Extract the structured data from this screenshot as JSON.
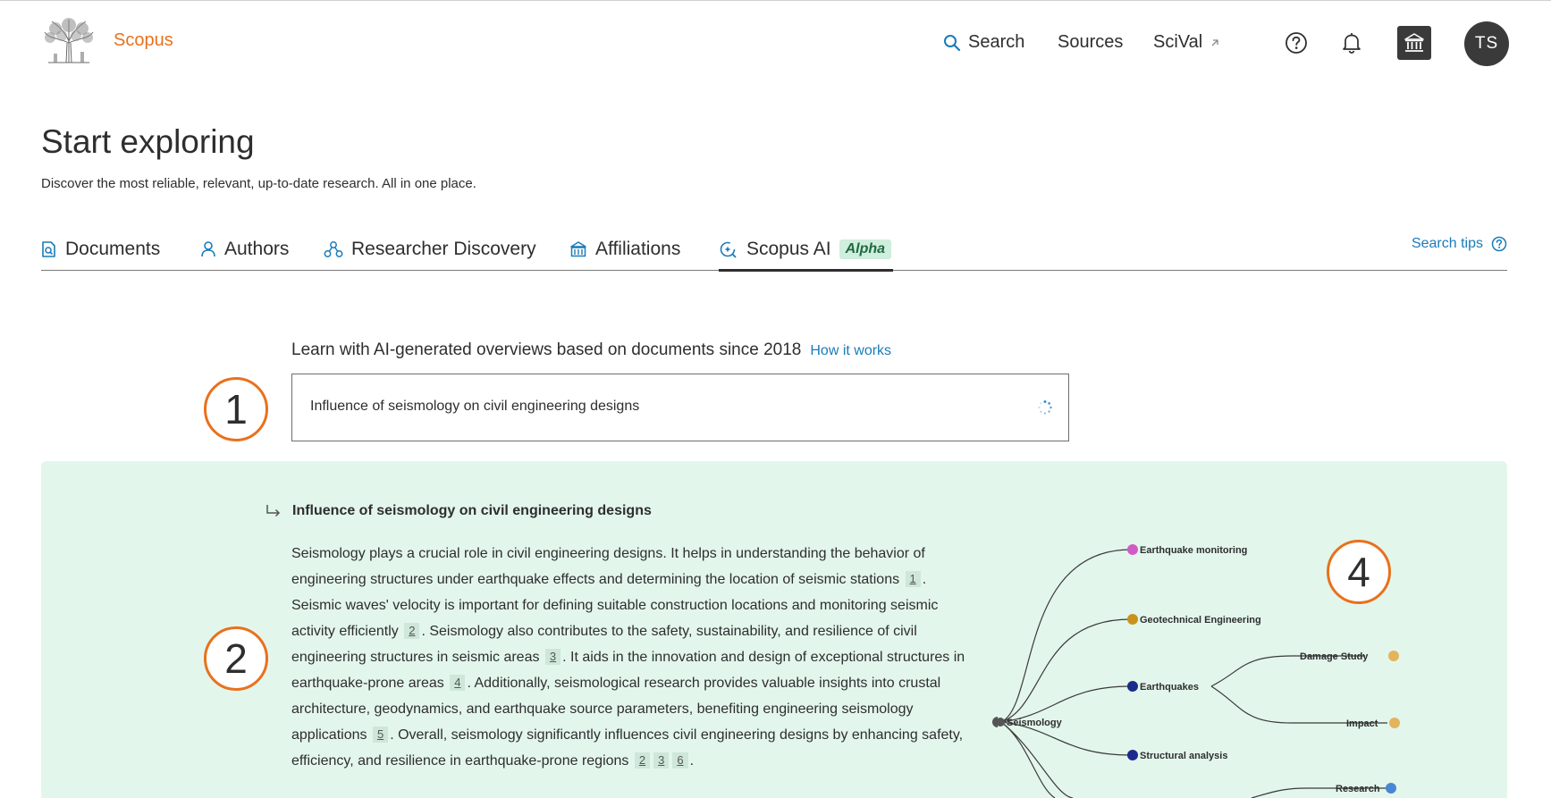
{
  "header": {
    "brand": "Scopus",
    "logo_icon": "elsevier-tree-logo",
    "nav": {
      "search": "Search",
      "sources": "Sources",
      "scival": "SciVal"
    },
    "user_initials": "TS"
  },
  "hero": {
    "title": "Start exploring",
    "subtitle": "Discover the most reliable, relevant, up-to-date research. All in one place."
  },
  "tabs": {
    "documents": "Documents",
    "authors": "Authors",
    "researcher_discovery": "Researcher Discovery",
    "affiliations": "Affiliations",
    "scopus_ai": "Scopus AI",
    "alpha_badge": "Alpha",
    "search_tips": "Search tips",
    "active": "Scopus AI"
  },
  "ai": {
    "prompt": "Learn with AI-generated overviews based on documents since 2018",
    "how_it_works": "How it works",
    "query_value": "Influence of seismology on civil engineering designs"
  },
  "callouts": {
    "one": "1",
    "two": "2",
    "four": "4"
  },
  "answer": {
    "heading": "Influence of seismology on civil engineering designs",
    "seg1": "Seismology plays a crucial role in civil engineering designs. It helps in understanding the behavior of engineering structures under earthquake effects and determining the location of seismic stations ",
    "seg2": ". Seismic waves' velocity is important for defining suitable construction locations and monitoring seismic activity efficiently ",
    "seg3": ". Seismology also contributes to the safety, sustainability, and resilience of civil engineering structures in seismic areas ",
    "seg4": ". It aids in the innovation and design of exceptional structures in earthquake-prone areas ",
    "seg5": ". Additionally, seismological research provides valuable insights into crustal architecture, geodynamics, and earthquake source parameters, benefiting engineering seismology applications ",
    "seg6": ". Overall, seismology significantly influences civil engineering designs by enhancing safety, efficiency, and resilience in earthquake-prone regions ",
    "seg7": ".",
    "citations": [
      "1",
      "2",
      "3",
      "4",
      "5",
      "2",
      "3",
      "6"
    ]
  },
  "mindmap": {
    "root": "Seismology",
    "branches": [
      "Earthquake monitoring",
      "Geotechnical Engineering",
      "Earthquakes",
      "Structural analysis"
    ],
    "leaves": [
      "Damage Study",
      "Impact",
      "Research"
    ],
    "colors": {
      "root": "#555555",
      "earthquake_monitoring": "#d05bc6",
      "geotechnical": "#c9921e",
      "earthquakes": "#1c2a8c",
      "structural": "#1c2a8c",
      "damage_study": "#e3b45c",
      "impact": "#e3b45c",
      "research": "#4a86d4"
    }
  },
  "colors": {
    "accent_orange": "#e9711c",
    "link_blue": "#1a7bb9",
    "panel_green": "#e3f6ec"
  }
}
